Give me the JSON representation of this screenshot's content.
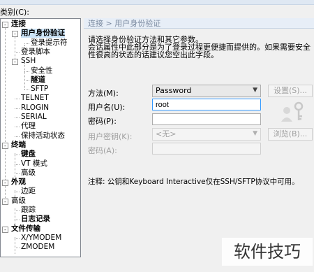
{
  "category_label": "类别(C):",
  "tree": [
    {
      "label": "连接",
      "bold": true,
      "exp": "-"
    },
    {
      "label": "用户身份验证",
      "bold": true,
      "exp": "-",
      "selected": true
    },
    {
      "label": "登录提示符",
      "bold": false
    },
    {
      "label": "登录脚本",
      "bold": false
    },
    {
      "label": "SSH",
      "bold": false,
      "exp": "-"
    },
    {
      "label": "安全性",
      "bold": false
    },
    {
      "label": "隧道",
      "bold": true
    },
    {
      "label": "SFTP",
      "bold": false
    },
    {
      "label": "TELNET",
      "bold": false
    },
    {
      "label": "RLOGIN",
      "bold": false
    },
    {
      "label": "SERIAL",
      "bold": false
    },
    {
      "label": "代理",
      "bold": false
    },
    {
      "label": "保持活动状态",
      "bold": false
    },
    {
      "label": "终端",
      "bold": true,
      "exp": "-"
    },
    {
      "label": "键盘",
      "bold": true
    },
    {
      "label": "VT 模式",
      "bold": false
    },
    {
      "label": "高级",
      "bold": false
    },
    {
      "label": "外观",
      "bold": true,
      "exp": "-"
    },
    {
      "label": "边距",
      "bold": false
    },
    {
      "label": "高级",
      "bold": false,
      "exp": "-"
    },
    {
      "label": "跟踪",
      "bold": false
    },
    {
      "label": "日志记录",
      "bold": true
    },
    {
      "label": "文件传输",
      "bold": true,
      "exp": "-"
    },
    {
      "label": "X/YMODEM",
      "bold": false
    },
    {
      "label": "ZMODEM",
      "bold": false
    }
  ],
  "panel": {
    "breadcrumb": "连接 > 用户身份验证",
    "description_1": "请选择身份验证方法和其它参数。",
    "description_2": "会话属性中此部分是为了登录过程更便捷而提供的。如果需要安全性很高的状态的话建议您空出此字段。",
    "method_label": "方法(M):",
    "method_value": "Password",
    "settings_button": "设置(S)...",
    "username_label": "用户名(U):",
    "username_value": "root",
    "password_label": "密码(P):",
    "password_value": "",
    "user_key_label": "用户密钥(K):",
    "user_key_value": "<无>",
    "browse_button": "浏览(B)...",
    "passphrase_label": "密码(A):",
    "passphrase_value": "",
    "note": "注释: 公钥和Keyboard Interactive仅在SSH/SFTP协议中可用。"
  },
  "watermark": "软件技巧",
  "colors": {
    "breadcrumb_text": "#7b8aa0",
    "selection": "#cce4f7",
    "disabled_text": "#a0a0a0"
  }
}
